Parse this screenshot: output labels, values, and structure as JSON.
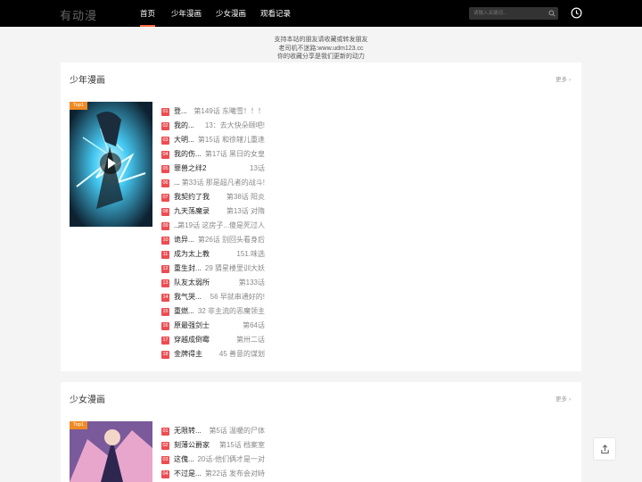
{
  "header": {
    "logo": "有动漫",
    "nav": [
      {
        "label": "首页",
        "active": true
      },
      {
        "label": "少年漫画",
        "active": false
      },
      {
        "label": "少女漫画",
        "active": false
      },
      {
        "label": "观看记录",
        "active": false
      }
    ],
    "search_placeholder": "请输入关键词...",
    "search_icon": "search-icon",
    "history_icon": "clock-icon"
  },
  "notice": {
    "line1": "支持本站的朋友请收藏或转发朋友",
    "line2": "老司机不迷路:www.udm123.cc",
    "line3": "你的收藏分享是我们更新的动力"
  },
  "sections": [
    {
      "title": "少年漫画",
      "more": "更多",
      "cover_tag": "Top1",
      "items": [
        {
          "num": "01",
          "title": "登...",
          "chapter": "第149话 东曦雪！！！"
        },
        {
          "num": "02",
          "title": "我的...",
          "chapter": "13：去大快朵颐吧!"
        },
        {
          "num": "03",
          "title": "大明...",
          "chapter": "第15话 和徐辖儿重逢"
        },
        {
          "num": "04",
          "title": "我的伤...",
          "chapter": "第17话 黑日的女皇"
        },
        {
          "num": "05",
          "title": "罪兽之绊2",
          "chapter": "13话"
        },
        {
          "num": "06",
          "title": "...",
          "chapter": "第33话 那是超凡者的战斗!"
        },
        {
          "num": "07",
          "title": "我契约了我",
          "chapter": "第38话 阳炎"
        },
        {
          "num": "08",
          "title": "九天荡魔录",
          "chapter": "第13话 对隋"
        },
        {
          "num": "09",
          "title": "...",
          "chapter": "第19话 这房子...傻是死过人"
        },
        {
          "num": "10",
          "title": "诡异...",
          "chapter": "第26话 别回头看身后"
        },
        {
          "num": "11",
          "title": "成为太上教",
          "chapter": "151.味选"
        },
        {
          "num": "12",
          "title": "重生封...",
          "chapter": "29 猜星楼里训大妖"
        },
        {
          "num": "13",
          "title": "队友太弱所",
          "chapter": "第133话"
        },
        {
          "num": "14",
          "title": "我气哭...",
          "chapter": "56 早就串通好的!"
        },
        {
          "num": "15",
          "title": "重燃...",
          "chapter": "32 非主流的恶魔领主"
        },
        {
          "num": "16",
          "title": "原最强剑士",
          "chapter": "第64话"
        },
        {
          "num": "17",
          "title": "穿越成倒霉",
          "chapter": "第卅二话"
        },
        {
          "num": "18",
          "title": "金牌得主",
          "chapter": "45 善意的谋划"
        }
      ]
    },
    {
      "title": "少女漫画",
      "more": "更多",
      "cover_tag": "Top1",
      "items": [
        {
          "num": "01",
          "title": "无限转...",
          "chapter": "第5话 温暖的尸体"
        },
        {
          "num": "02",
          "title": "刻薄公爵家",
          "chapter": "第15话 档案室"
        },
        {
          "num": "03",
          "title": "这傀...",
          "chapter": "20话-他们俩才是一对"
        },
        {
          "num": "04",
          "title": "不过是...",
          "chapter": "第22话 发布会对峙"
        }
      ]
    }
  ],
  "share_icon": "share-icon"
}
